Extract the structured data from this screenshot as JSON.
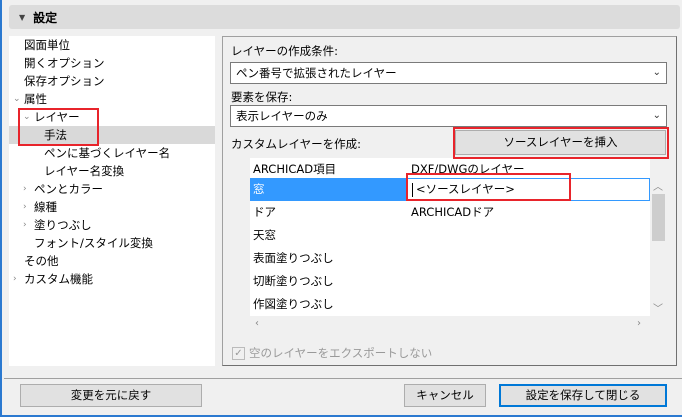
{
  "header": {
    "title": "設定"
  },
  "tree": [
    {
      "label": "図面単位",
      "level": 0,
      "chevron": ""
    },
    {
      "label": "開くオプション",
      "level": 0,
      "chevron": ""
    },
    {
      "label": "保存オプション",
      "level": 0,
      "chevron": ""
    },
    {
      "label": "属性",
      "level": 0,
      "chevron": "expanded"
    },
    {
      "label": "レイヤー",
      "level": 1,
      "chevron": "expanded"
    },
    {
      "label": "手法",
      "level": 2,
      "chevron": "",
      "selected": true
    },
    {
      "label": "ペンに基づくレイヤー名",
      "level": 2,
      "chevron": ""
    },
    {
      "label": "レイヤー名変換",
      "level": 2,
      "chevron": ""
    },
    {
      "label": "ペンとカラー",
      "level": 1,
      "chevron": "collapsed"
    },
    {
      "label": "線種",
      "level": 1,
      "chevron": "collapsed"
    },
    {
      "label": "塗りつぶし",
      "level": 1,
      "chevron": "collapsed"
    },
    {
      "label": "フォント/スタイル変換",
      "level": 1,
      "chevron": ""
    },
    {
      "label": "その他",
      "level": 0,
      "chevron": ""
    },
    {
      "label": "カスタム機能",
      "level": 0,
      "chevron": "collapsed"
    }
  ],
  "main": {
    "creation_label": "レイヤーの作成条件:",
    "creation_value": "ペン番号で拡張されたレイヤー",
    "save_label": "要素を保存:",
    "save_value": "表示レイヤーのみ",
    "custom_label": "カスタムレイヤーを作成:",
    "insert_button": "ソースレイヤーを挿入",
    "table": {
      "headers": [
        "ARCHICAD項目",
        "DXF/DWGのレイヤー"
      ],
      "rows": [
        [
          "窓",
          "<ソースレイヤー>"
        ],
        [
          "ドア",
          "ARCHICADドア"
        ],
        [
          "天窓",
          ""
        ],
        [
          "表面塗りつぶし",
          ""
        ],
        [
          "切断塗りつぶし",
          ""
        ],
        [
          "作図塗りつぶし",
          ""
        ]
      ]
    },
    "checkbox_label": "空のレイヤーをエクスポートしない",
    "checkbox_checked": true
  },
  "footer": {
    "revert": "変更を元に戻す",
    "cancel": "キャンセル",
    "save_close": "設定を保存して閉じる"
  }
}
